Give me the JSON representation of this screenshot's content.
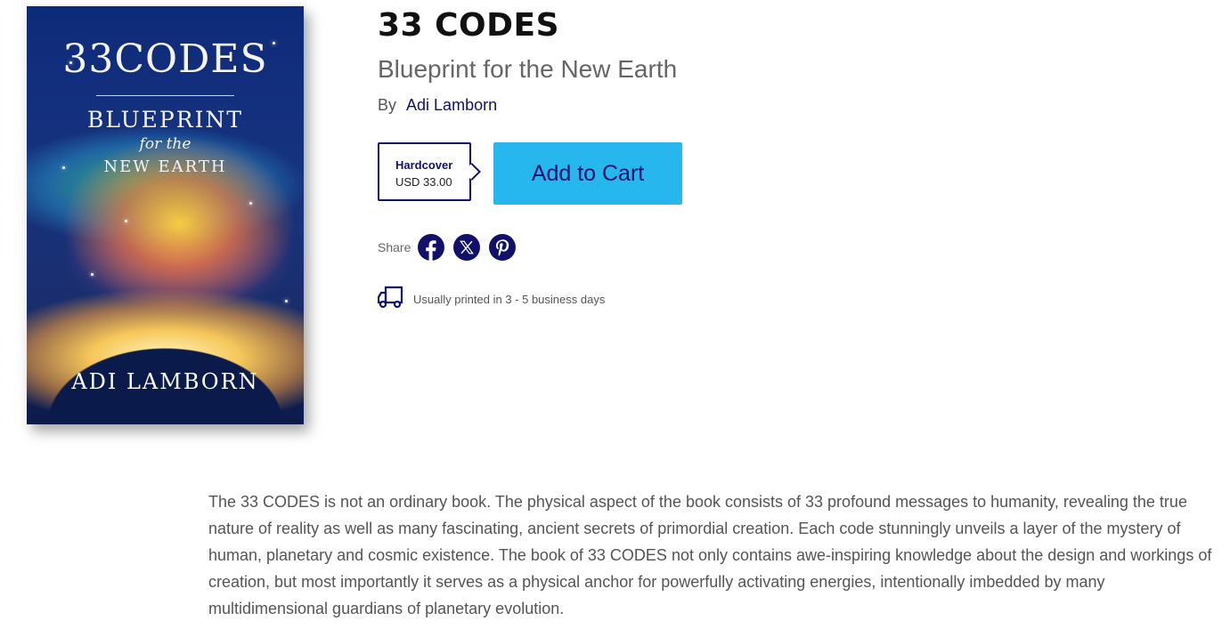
{
  "cover": {
    "title_line1": "33CODES",
    "title_line2": "BLUEPRINT",
    "title_line3": "for the",
    "title_line4": "NEW EARTH",
    "author": "ADI LAMBORN"
  },
  "product": {
    "title": "33 CODES",
    "subtitle": "Blueprint for the New Earth",
    "by_label": "By",
    "author": "Adi Lamborn"
  },
  "format_option": {
    "name": "Hardcover",
    "price": "USD 33.00"
  },
  "add_to_cart_label": "Add to Cart",
  "share": {
    "label": "Share",
    "icons": [
      "facebook-icon",
      "x-twitter-icon",
      "pinterest-icon"
    ]
  },
  "shipping": {
    "icon": "delivery-truck-icon",
    "text": "Usually printed in 3 - 5 business days"
  },
  "description": "The 33 CODES is not an ordinary book. The physical aspect of the book consists of 33 profound messages to humanity, revealing the true nature of reality as well as many fascinating, ancient secrets of primordial creation. Each code stunningly unveils a layer of the mystery of human, planetary and cosmic existence. The book of 33 CODES not only contains awe-inspiring knowledge about the design and workings of creation, but most importantly it serves as a physical anchor for powerfully activating energies, intentionally imbedded by many multidimensional guardians of planetary evolution.",
  "colors": {
    "accent_navy": "#11116b",
    "button_blue": "#26b7ef",
    "text_gray": "#555555"
  }
}
